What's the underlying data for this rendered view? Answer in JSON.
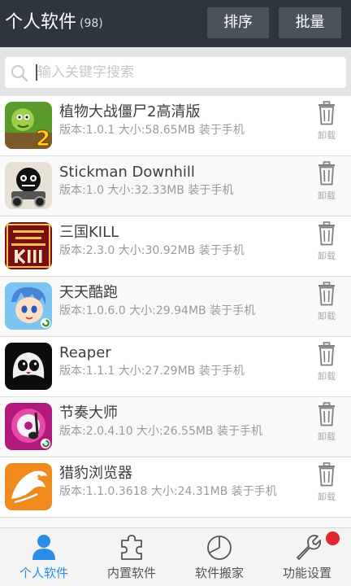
{
  "header": {
    "title": "个人软件",
    "count": "(98)",
    "sort_label": "排序",
    "batch_label": "批量"
  },
  "search": {
    "placeholder": "输入关键字搜索"
  },
  "apps": [
    {
      "name": "植物大战僵尸2高清版",
      "meta": "版本:1.0.1 大小:58.65MB 装于手机",
      "icon": "plants-vs-zombies-icon",
      "uninstall": "卸载"
    },
    {
      "name": "Stickman Downhill",
      "meta": "版本:1.0 大小:32.33MB 装于手机",
      "icon": "stickman-downhill-icon",
      "uninstall": "卸载"
    },
    {
      "name": "三国KILL",
      "meta": "版本:2.3.0 大小:30.92MB 装于手机",
      "icon": "sanguo-kill-icon",
      "uninstall": "卸载"
    },
    {
      "name": "天天酷跑",
      "meta": "版本:1.0.6.0 大小:29.94MB 装于手机",
      "icon": "tiantian-kupao-icon",
      "uninstall": "卸载"
    },
    {
      "name": "Reaper",
      "meta": "版本:1.1.1 大小:27.29MB 装于手机",
      "icon": "reaper-icon",
      "uninstall": "卸载"
    },
    {
      "name": "节奏大师",
      "meta": "版本:2.0.4.10 大小:26.55MB 装于手机",
      "icon": "rhythm-master-icon",
      "uninstall": "卸载"
    },
    {
      "name": "猎豹浏览器",
      "meta": "版本:1.1.0.3618 大小:24.31MB 装于手机",
      "icon": "liebao-browser-icon",
      "uninstall": "卸载"
    }
  ],
  "tabs": [
    {
      "label": "个人软件",
      "icon": "person-icon",
      "active": true
    },
    {
      "label": "内置软件",
      "icon": "puzzle-icon",
      "active": false
    },
    {
      "label": "软件搬家",
      "icon": "pie-chart-icon",
      "active": false
    },
    {
      "label": "功能设置",
      "icon": "wrench-icon",
      "active": false
    }
  ],
  "colors": {
    "header_bg": "#2e353f",
    "header_button_bg": "#4a525c",
    "active_tab": "#2b8ee6",
    "badge": "#e3262b"
  }
}
